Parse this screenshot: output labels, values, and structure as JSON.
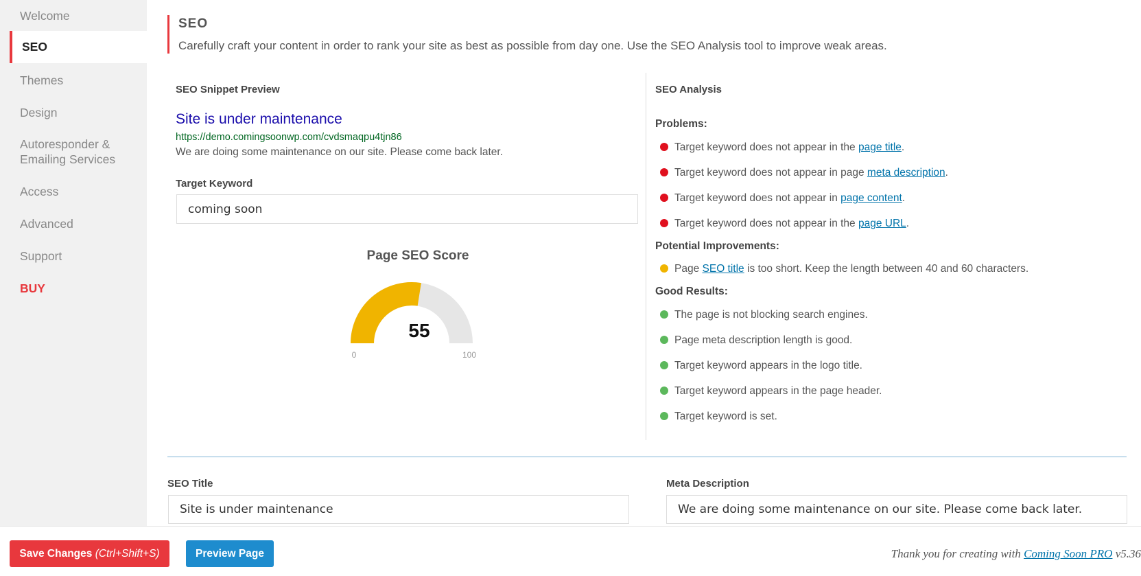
{
  "sidebar": {
    "items": [
      {
        "label": "Welcome"
      },
      {
        "label": "SEO"
      },
      {
        "label": "Themes"
      },
      {
        "label": "Design"
      },
      {
        "label": "Autoresponder &"
      },
      {
        "label": "Emailing Services"
      },
      {
        "label": "Access"
      },
      {
        "label": "Advanced"
      },
      {
        "label": "Support"
      },
      {
        "label": "BUY"
      }
    ]
  },
  "header": {
    "title": "SEO",
    "description": "Carefully craft your content in order to rank your site as best as possible from day one. Use the SEO Analysis tool to improve weak areas."
  },
  "snippet": {
    "heading": "SEO Snippet Preview",
    "title": "Site is under maintenance",
    "url": "https://demo.comingsoonwp.com/cvdsmaqpu4tjn86",
    "description": "We are doing some maintenance on our site. Please come back later."
  },
  "keyword": {
    "label": "Target Keyword",
    "value": "coming soon"
  },
  "score": {
    "title": "Page SEO Score",
    "value": 55,
    "value_text": "55",
    "min": "0",
    "max": "100",
    "fill_color": "#f0b400",
    "track_color": "#e6e6e6"
  },
  "analysis": {
    "heading": "SEO Analysis",
    "problems_label": "Problems:",
    "problems": [
      {
        "pre": "Target keyword does not appear in the ",
        "link": "page title",
        "post": "."
      },
      {
        "pre": "Target keyword does not appear in page ",
        "link": "meta description",
        "post": "."
      },
      {
        "pre": "Target keyword does not appear in ",
        "link": "page content",
        "post": "."
      },
      {
        "pre": "Target keyword does not appear in the ",
        "link": "page URL",
        "post": "."
      }
    ],
    "improvements_label": "Potential Improvements:",
    "improvements": [
      {
        "pre": "Page ",
        "link": "SEO title",
        "post": " is too short. Keep the length between 40 and 60 characters."
      }
    ],
    "good_label": "Good Results:",
    "good": [
      {
        "text": "The page is not blocking search engines."
      },
      {
        "text": "Page meta description length is good."
      },
      {
        "text": "Target keyword appears in the logo title."
      },
      {
        "text": "Target keyword appears in the page header."
      },
      {
        "text": "Target keyword is set."
      }
    ],
    "colors": {
      "problem": "#e0101e",
      "improvement": "#f0b400",
      "good": "#5cb85c"
    }
  },
  "seo_title": {
    "label": "SEO Title",
    "value": "Site is under maintenance"
  },
  "meta_description": {
    "label": "Meta Description",
    "value": "We are doing some maintenance on our site. Please come back later."
  },
  "footer": {
    "save_label": "Save Changes",
    "save_shortcut": "(Ctrl+Shift+S)",
    "preview_label": "Preview Page",
    "thanks_pre": "Thank you for creating with ",
    "thanks_link": "Coming Soon PRO",
    "thanks_post": " v5.36"
  }
}
